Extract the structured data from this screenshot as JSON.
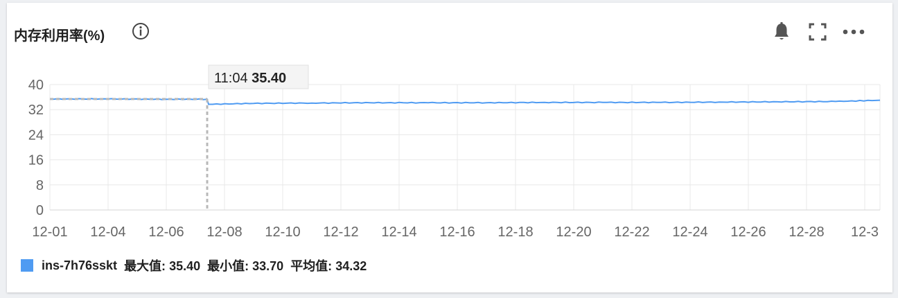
{
  "panel": {
    "title": "内存利用率(%)",
    "icons": [
      "info-icon",
      "bell-icon",
      "fullscreen-icon",
      "more-icon"
    ]
  },
  "chart_data": {
    "type": "line",
    "title": "内存利用率(%)",
    "xlabel": "",
    "ylabel": "",
    "y_ticks": [
      0,
      8,
      16,
      24,
      32,
      40
    ],
    "ylim": [
      0,
      40
    ],
    "x_tick_labels": [
      "12-01",
      "12-04",
      "12-06",
      "12-08",
      "12-10",
      "12-12",
      "12-14",
      "12-16",
      "12-18",
      "12-20",
      "12-22",
      "12-24",
      "12-26",
      "12-28",
      "12-3"
    ],
    "grid": true,
    "color": "#4f9bf2",
    "series": [
      {
        "name": "ins-7h76sskt",
        "x": [
          "12-01",
          "12-04",
          "12-06",
          "12-07",
          "12-07",
          "12-08",
          "12-10",
          "12-12",
          "12-14",
          "12-16",
          "12-18",
          "12-20",
          "12-22",
          "12-24",
          "12-26",
          "12-28",
          "12-30"
        ],
        "values": [
          35.4,
          35.4,
          35.3,
          35.3,
          33.7,
          34.0,
          34.1,
          34.2,
          34.2,
          34.2,
          34.3,
          34.3,
          34.3,
          34.4,
          34.5,
          34.6,
          35.0
        ]
      }
    ],
    "tooltip": {
      "time": "11:04",
      "value": "35.40"
    },
    "stats": [
      {
        "label": "最大值:",
        "value": "35.40"
      },
      {
        "label": "最小值:",
        "value": "33.70"
      },
      {
        "label": "平均值:",
        "value": "34.32"
      }
    ]
  }
}
